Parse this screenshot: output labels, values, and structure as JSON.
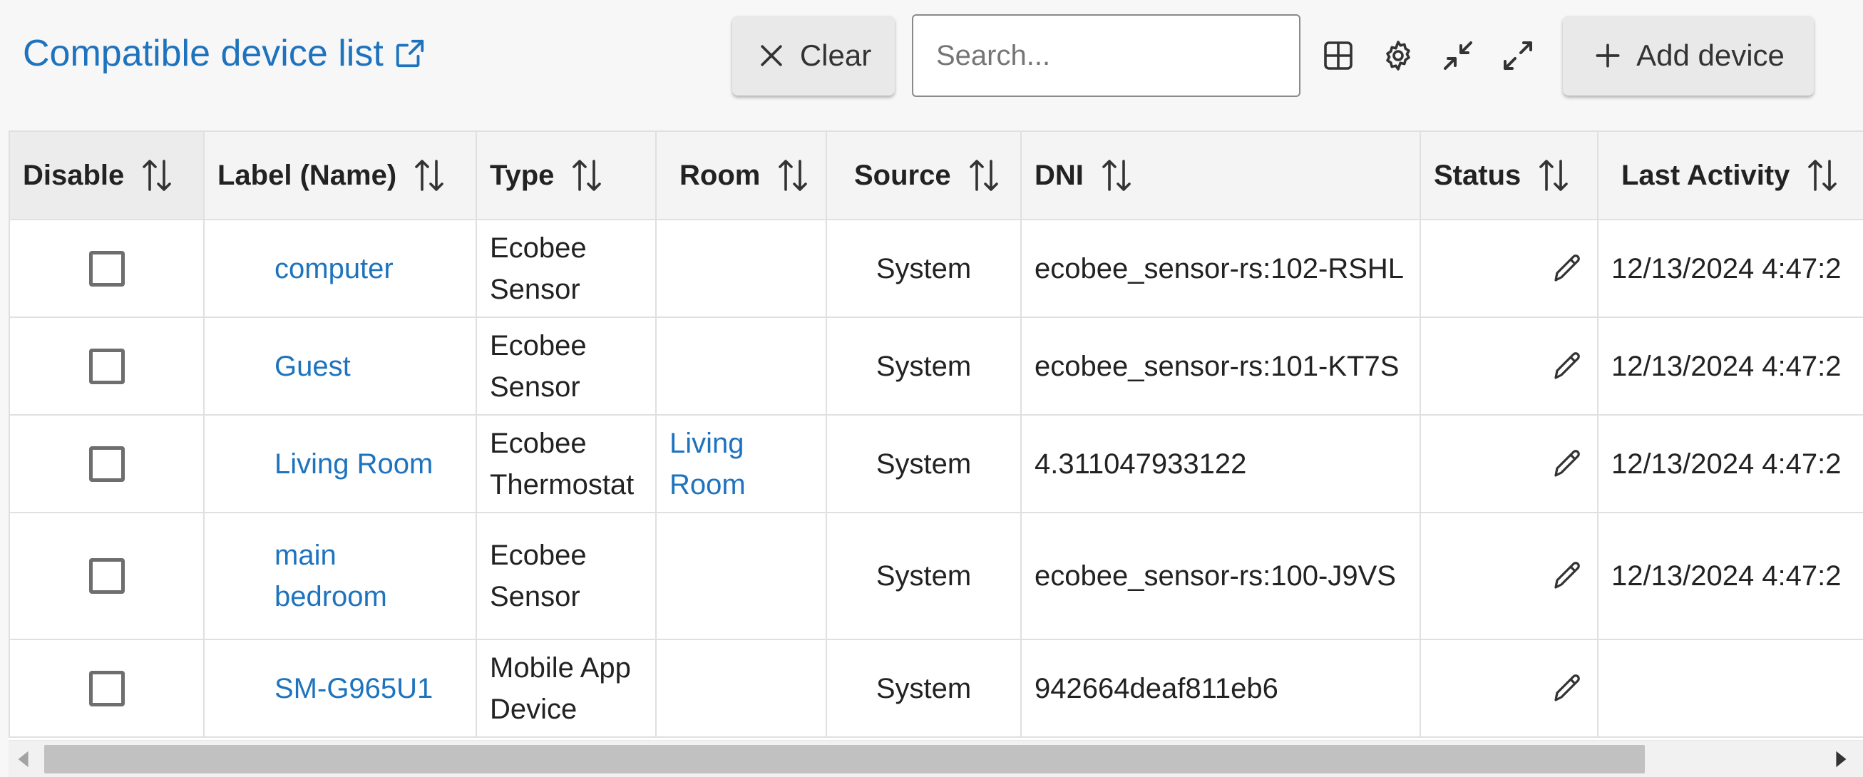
{
  "header": {
    "title": "Compatible device list",
    "clear_label": "Clear",
    "search_placeholder": "Search...",
    "add_label": "Add device",
    "accent_color": "#1e73be"
  },
  "columns": [
    {
      "label": "Disable"
    },
    {
      "label": "Label (Name)"
    },
    {
      "label": "Type"
    },
    {
      "label": "Room"
    },
    {
      "label": "Source"
    },
    {
      "label": "DNI"
    },
    {
      "label": "Status"
    },
    {
      "label": "Last Activity"
    }
  ],
  "rows": [
    {
      "label": "computer",
      "type": "Ecobee Sensor",
      "room": "",
      "source": "System",
      "dni": "ecobee_sensor-rs:102-RSHL",
      "last_activity": "12/13/2024 4:47:2"
    },
    {
      "label": "Guest",
      "type": "Ecobee Sensor",
      "room": "",
      "source": "System",
      "dni": "ecobee_sensor-rs:101-KT7S",
      "last_activity": "12/13/2024 4:47:2"
    },
    {
      "label": "Living Room",
      "type": "Ecobee Thermostat",
      "room": "Living Room",
      "source": "System",
      "dni": "4.311047933122",
      "last_activity": "12/13/2024 4:47:2"
    },
    {
      "label": "main bedroom",
      "type": "Ecobee Sensor",
      "room": "",
      "source": "System",
      "dni": "ecobee_sensor-rs:100-J9VS",
      "last_activity": "12/13/2024 4:47:2"
    },
    {
      "label": "SM-G965U1",
      "type": "Mobile App Device",
      "room": "",
      "source": "System",
      "dni": "942664deaf811eb6",
      "last_activity": ""
    }
  ],
  "icons": {
    "external": "external-link-icon",
    "clear": "close-icon",
    "columns": "grid-icon",
    "settings": "gear-icon",
    "collapse": "collapse-icon",
    "expand": "expand-icon",
    "add": "plus-icon",
    "sort": "sort-icon",
    "edit": "pencil-icon"
  }
}
